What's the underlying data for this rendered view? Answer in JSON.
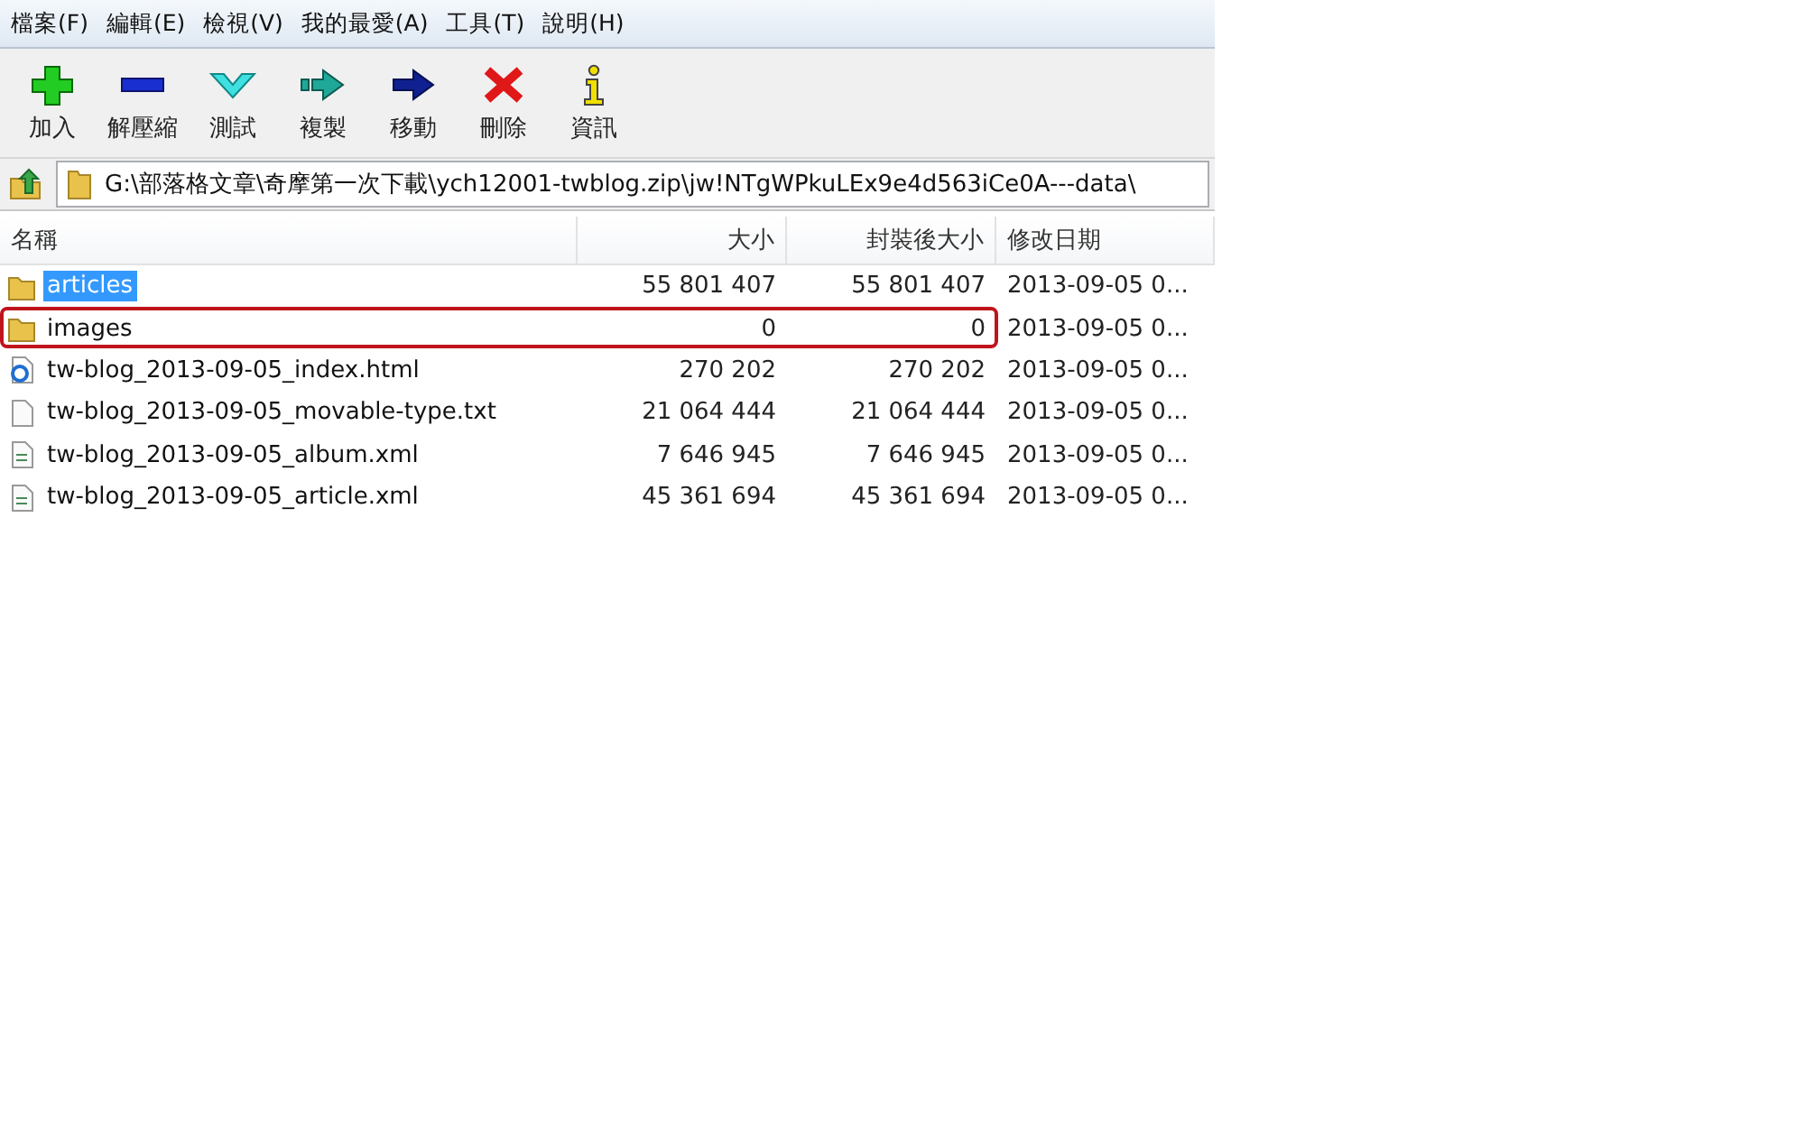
{
  "menu": [
    "檔案(F)",
    "編輯(E)",
    "檢視(V)",
    "我的最愛(A)",
    "工具(T)",
    "說明(H)"
  ],
  "toolbar": [
    {
      "kind": "add",
      "label": "加入"
    },
    {
      "kind": "extract",
      "label": "解壓縮"
    },
    {
      "kind": "test",
      "label": "測試"
    },
    {
      "kind": "copy",
      "label": "複製"
    },
    {
      "kind": "move",
      "label": "移動"
    },
    {
      "kind": "delete",
      "label": "刪除"
    },
    {
      "kind": "info",
      "label": "資訊"
    }
  ],
  "address": {
    "path": "G:\\部落格文章\\奇摩第一次下載\\ych12001-twblog.zip\\jw!NTgWPkuLEx9e4d563iCe0A---data\\"
  },
  "table": {
    "columns": [
      "名稱",
      "大小",
      "封裝後大小",
      "修改日期"
    ],
    "rows": [
      {
        "kind": "folder",
        "name": "articles",
        "size": "55 801 407",
        "packed": "55 801 407",
        "modified": "2013-09-05 0...",
        "selected": true,
        "annotated": false
      },
      {
        "kind": "folder",
        "name": "images",
        "size": "0",
        "packed": "0",
        "modified": "2013-09-05 0...",
        "selected": false,
        "annotated": true
      },
      {
        "kind": "html",
        "name": "tw-blog_2013-09-05_index.html",
        "size": "270 202",
        "packed": "270 202",
        "modified": "2013-09-05 0...",
        "selected": false,
        "annotated": false
      },
      {
        "kind": "txt",
        "name": "tw-blog_2013-09-05_movable-type.txt",
        "size": "21 064 444",
        "packed": "21 064 444",
        "modified": "2013-09-05 0...",
        "selected": false,
        "annotated": false
      },
      {
        "kind": "xml",
        "name": "tw-blog_2013-09-05_album.xml",
        "size": "7 646 945",
        "packed": "7 646 945",
        "modified": "2013-09-05 0...",
        "selected": false,
        "annotated": false
      },
      {
        "kind": "xml",
        "name": "tw-blog_2013-09-05_article.xml",
        "size": "45 361 694",
        "packed": "45 361 694",
        "modified": "2013-09-05 0...",
        "selected": false,
        "annotated": false
      }
    ]
  }
}
